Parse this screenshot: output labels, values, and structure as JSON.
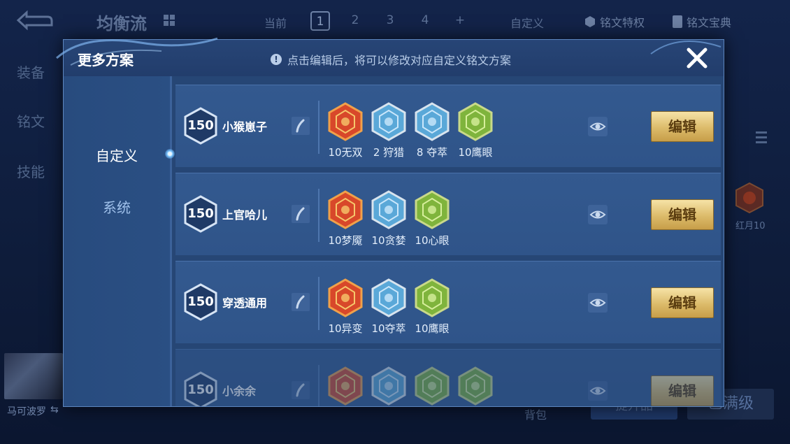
{
  "background": {
    "title": "均衡流",
    "current_label": "当前",
    "pages": [
      "1",
      "2",
      "3",
      "4",
      "+"
    ],
    "active_page": "1",
    "custom_label": "自定义",
    "privilege_label": "铭文特权",
    "dictionary_label": "铭文宝典",
    "side_nav": [
      "装备",
      "铭文",
      "技能"
    ],
    "hero_name": "马可波罗",
    "swap_glyph": "⇆",
    "bag_label": "背包",
    "upgrade_button": "提升品",
    "max_button": "已满级",
    "side_rune_label": "红月10"
  },
  "modal": {
    "title": "更多方案",
    "hint": "点击编辑后，将可以修改对应自定义铭文方案",
    "hint_icon": "!",
    "tabs": [
      {
        "label": "自定义",
        "active": true
      },
      {
        "label": "系统",
        "active": false
      }
    ],
    "edit_label": "编辑",
    "schemes": [
      {
        "level": "150",
        "name": "小猴崽子",
        "runes": [
          {
            "label": "10无双",
            "color": "red",
            "icon": "rune-red-wushuang-icon"
          },
          {
            "label": "2 狩猎",
            "color": "blue",
            "icon": "rune-blue-shoulie-icon"
          },
          {
            "label": "8 夺萃",
            "color": "blue",
            "icon": "rune-blue-duocui-icon"
          },
          {
            "label": "10鹰眼",
            "color": "green",
            "icon": "rune-green-yingyan-icon"
          }
        ]
      },
      {
        "level": "150",
        "name": "上官哈儿",
        "runes": [
          {
            "label": "10梦魇",
            "color": "red",
            "icon": "rune-red-mengyan-icon"
          },
          {
            "label": "10贪婪",
            "color": "blue",
            "icon": "rune-blue-tanlan-icon"
          },
          {
            "label": "10心眼",
            "color": "green",
            "icon": "rune-green-xinyan-icon"
          }
        ]
      },
      {
        "level": "150",
        "name": "穿透通用",
        "runes": [
          {
            "label": "10异变",
            "color": "red",
            "icon": "rune-red-yibian-icon"
          },
          {
            "label": "10夺萃",
            "color": "blue",
            "icon": "rune-blue-duocui-icon"
          },
          {
            "label": "10鹰眼",
            "color": "green",
            "icon": "rune-green-yingyan-icon"
          }
        ]
      },
      {
        "level": "150",
        "name": "小余余",
        "runes": [
          {
            "label": "",
            "color": "red",
            "icon": "rune-red-icon"
          },
          {
            "label": "",
            "color": "blue",
            "icon": "rune-blue-icon"
          },
          {
            "label": "",
            "color": "green",
            "icon": "rune-green-icon"
          },
          {
            "label": "",
            "color": "green",
            "icon": "rune-green-icon"
          }
        ]
      }
    ]
  },
  "colors": {
    "modal_bg": "#2c4d7e",
    "row_bg": "#33598f",
    "edit_gold": "#dcbb6a",
    "rune_red": "#d8482a",
    "rune_blue": "#5aa8d8",
    "rune_green": "#7fb43c"
  }
}
